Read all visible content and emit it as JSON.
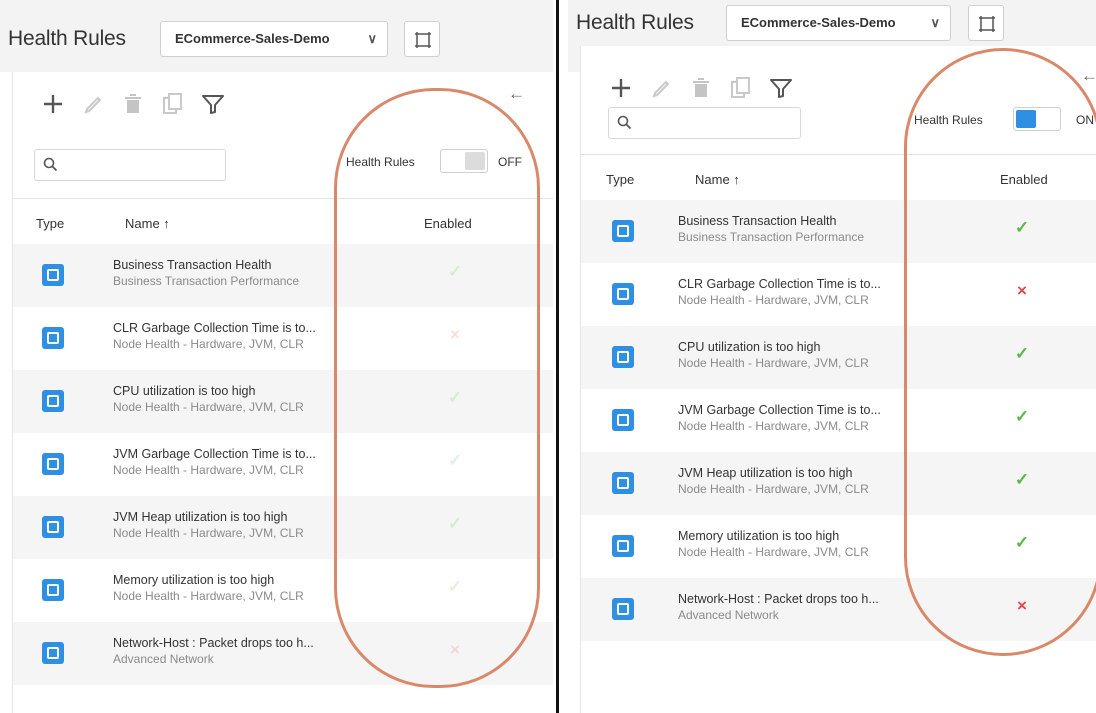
{
  "colors": {
    "accent": "#2f8fe3",
    "check": "#58b947",
    "cross": "#e0494a",
    "highlight": "#d9896a"
  },
  "icons": [
    "add-icon",
    "edit-icon",
    "delete-icon",
    "copy-icon",
    "filter-icon",
    "back-arrow-icon",
    "search-icon",
    "layout-icon",
    "chevron-down-icon"
  ],
  "header": {
    "title": "Health Rules",
    "application": "ECommerce-Sales-Demo",
    "chevron": "∨"
  },
  "toolbar": {
    "back_arrow": "←"
  },
  "search": {
    "placeholder": ""
  },
  "table": {
    "columns": {
      "type": "Type",
      "name": "Name ↑",
      "enabled": "Enabled"
    },
    "rows": [
      {
        "name": "Business Transaction Health",
        "sub": "Business Transaction Performance",
        "enabled": true
      },
      {
        "name": "CLR Garbage Collection Time is to...",
        "sub": "Node Health - Hardware, JVM, CLR",
        "enabled": false
      },
      {
        "name": "CPU utilization is too high",
        "sub": "Node Health - Hardware, JVM, CLR",
        "enabled": true
      },
      {
        "name": "JVM Garbage Collection Time is to...",
        "sub": "Node Health - Hardware, JVM, CLR",
        "enabled": true
      },
      {
        "name": "JVM Heap utilization is too high",
        "sub": "Node Health - Hardware, JVM, CLR",
        "enabled": true
      },
      {
        "name": "Memory utilization is too high",
        "sub": "Node Health - Hardware, JVM, CLR",
        "enabled": true
      },
      {
        "name": "Network-Host : Packet drops too h...",
        "sub": "Advanced Network",
        "enabled": false
      }
    ]
  },
  "panels": {
    "left": {
      "toggle_label": "Health Rules",
      "toggle_state": "OFF",
      "toggle_on": false
    },
    "right": {
      "toggle_label": "Health Rules",
      "toggle_state": "ON",
      "toggle_on": true
    }
  },
  "glyphs": {
    "check": "✓",
    "cross": "×"
  }
}
